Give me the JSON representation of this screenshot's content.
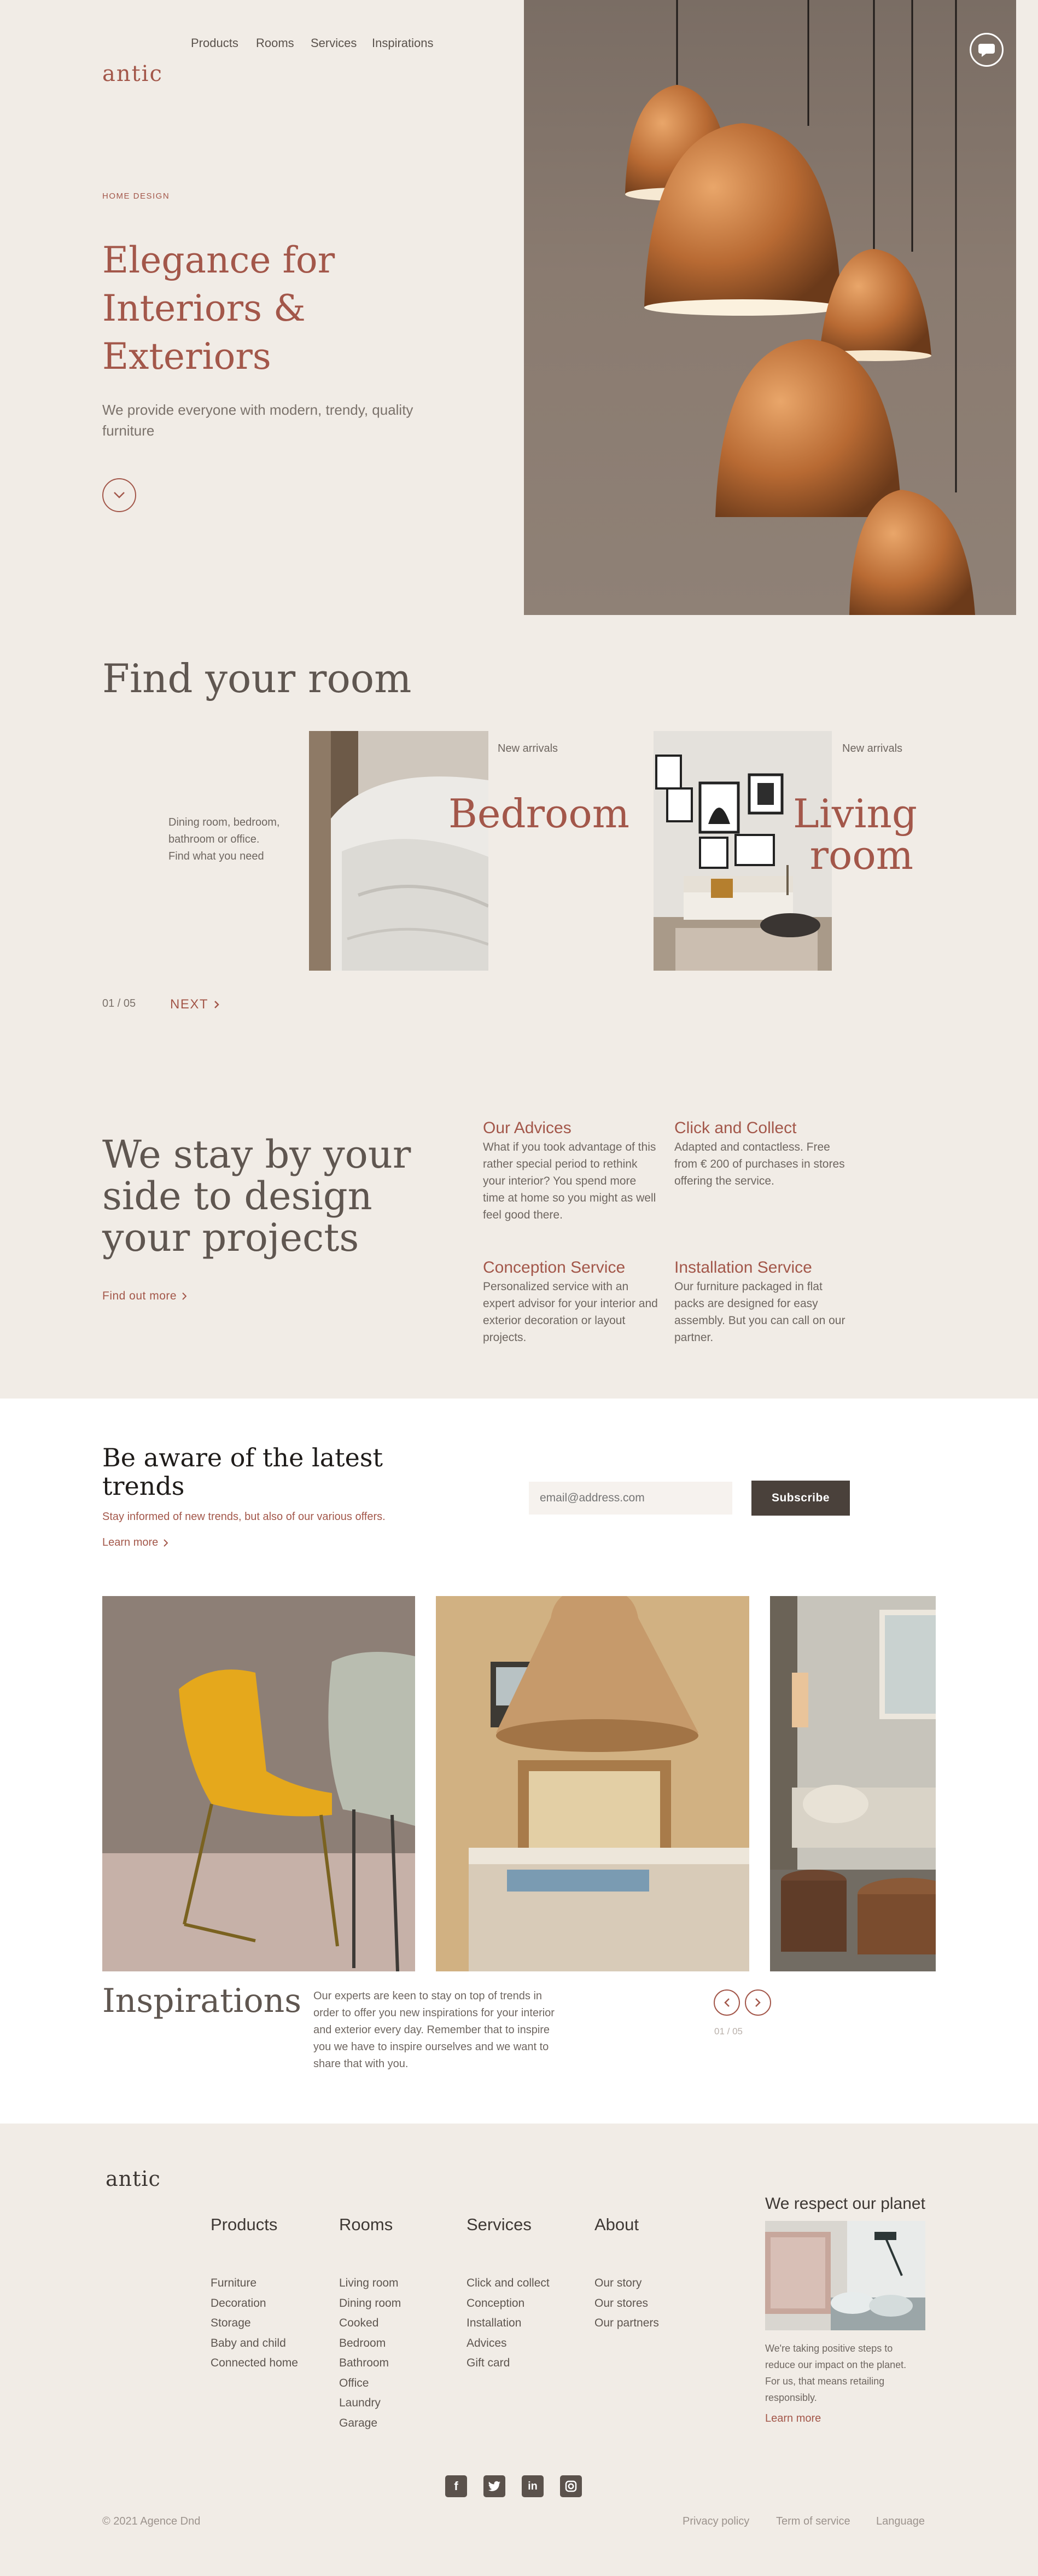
{
  "brand": {
    "logo": "antic"
  },
  "nav": {
    "items": [
      "Products",
      "Rooms",
      "Services",
      "Inspirations"
    ]
  },
  "hero": {
    "kicker": "HOME DESIGN",
    "title_lines": [
      "Elegance for",
      "Interiors &",
      "Exteriors"
    ],
    "subtitle": "We provide everyone with modern, trendy, quality furniture"
  },
  "rooms": {
    "heading": "Find your room",
    "intro": "Dining room, bedroom, bathroom or office. Find what you need",
    "cards": [
      {
        "tag": "New arrivals",
        "name_lines": [
          "Bedroom"
        ]
      },
      {
        "tag": "New arrivals",
        "name_lines": [
          "Living",
          "room"
        ]
      }
    ],
    "pager": "01 / 05",
    "next_label": "NEXT"
  },
  "services": {
    "heading_lines": [
      "We stay by your",
      "side to design",
      "your projects"
    ],
    "cta": "Find out more",
    "items": [
      {
        "title": "Our Advices",
        "text": "What if you took advantage of this rather special period to rethink your interior? You spend more time at home so you might as well feel good there."
      },
      {
        "title": "Click and Collect",
        "text": "Adapted and contactless. Free from € 200 of purchases in stores offering the service."
      },
      {
        "title": "Conception Service",
        "text": "Personalized service with an expert advisor for your interior and exterior decoration or layout projects."
      },
      {
        "title": "Installation Service",
        "text": "Our furniture packaged in flat packs are designed for easy assembly. But you can call on our partner."
      }
    ]
  },
  "newsletter": {
    "heading_lines": [
      "Be aware of the latest",
      "trends"
    ],
    "text": "Stay informed of new trends, but also of our various offers.",
    "learn_more": "Learn more",
    "email_placeholder": "email@address.com",
    "subscribe": "Subscribe"
  },
  "inspirations": {
    "heading": "Inspirations",
    "text": "Our experts are keen to stay on top of trends in order to offer you new inspirations for your interior and exterior every day. Remember that to inspire you we have to inspire ourselves and we want to share that with you.",
    "pager": "01 / 05"
  },
  "footer": {
    "logo": "antic",
    "columns": [
      {
        "title": "Products",
        "items": [
          "Furniture",
          "Decoration",
          "Storage",
          "Baby and child",
          "Connected home"
        ]
      },
      {
        "title": "Rooms",
        "items": [
          "Living room",
          "Dining room",
          "Cooked",
          "Bedroom",
          "Bathroom",
          "Office",
          "Laundry",
          "Garage"
        ]
      },
      {
        "title": "Services",
        "items": [
          "Click and collect",
          "Conception",
          "Installation",
          "Advices",
          "Gift card"
        ]
      },
      {
        "title": "About",
        "items": [
          "Our story",
          "Our stores",
          "Our partners"
        ]
      }
    ],
    "planet": {
      "title": "We respect our planet",
      "text": "We're taking positive steps to reduce our impact on the planet. For us, that means retailing responsibly.",
      "link": "Learn more"
    },
    "social": [
      "facebook-icon",
      "twitter-icon",
      "linkedin-icon",
      "instagram-icon"
    ],
    "copyright": "© 2021 Agence Dnd",
    "legal": [
      "Privacy policy",
      "Term of service",
      "Language"
    ]
  },
  "colors": {
    "accent": "#a3574a",
    "background": "#f1ece6",
    "dark": "#4a413b"
  }
}
